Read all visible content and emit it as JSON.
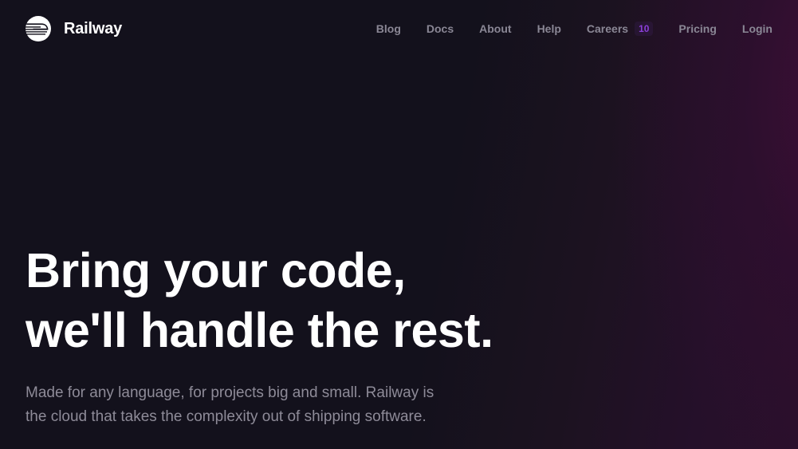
{
  "brand": {
    "name": "Railway",
    "logo_icon": "railway-train-logo-icon"
  },
  "nav": {
    "items": [
      {
        "label": "Blog"
      },
      {
        "label": "Docs"
      },
      {
        "label": "About"
      },
      {
        "label": "Help"
      },
      {
        "label": "Careers",
        "badge": "10"
      },
      {
        "label": "Pricing"
      },
      {
        "label": "Login"
      }
    ]
  },
  "hero": {
    "title_line1": "Bring your code,",
    "title_line2": "we'll handle the rest.",
    "subtitle_line1": "Made for any language, for projects big and small. Railway is",
    "subtitle_line2": "the cloud that takes the complexity out of shipping software."
  },
  "colors": {
    "background": "#13111c",
    "background_accent": "#2a0f2b",
    "nav_text": "#8a8795",
    "badge_text": "#8b3fd9",
    "heading_text": "#ffffff",
    "body_text": "#8e8b98"
  }
}
